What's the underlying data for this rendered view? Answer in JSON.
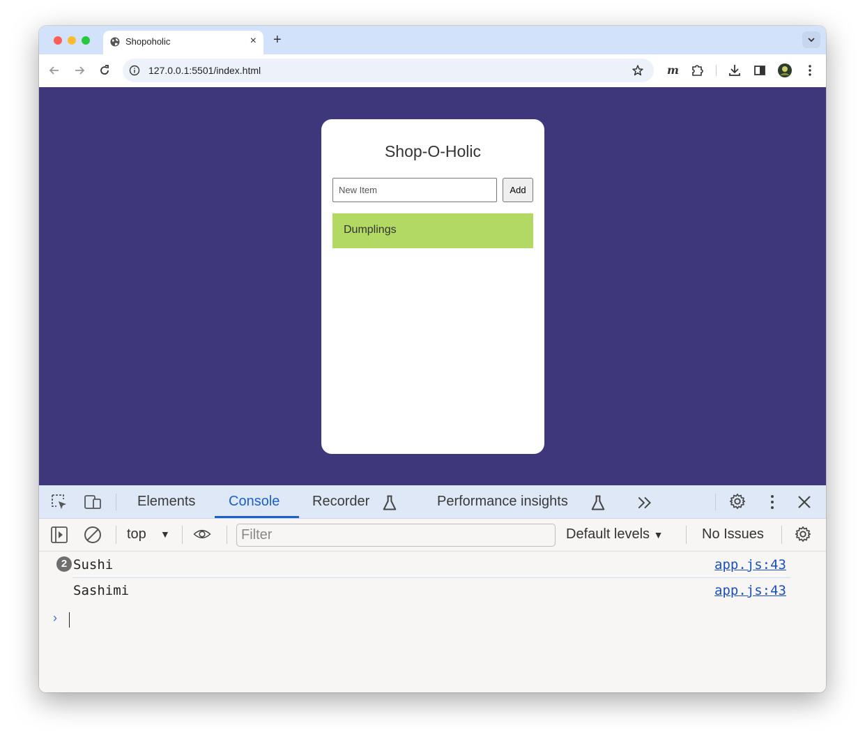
{
  "browser": {
    "tab": {
      "title": "Shopoholic",
      "close": "×"
    },
    "new_tab": "+",
    "address_bar": {
      "url": "127.0.0.1:5501/index.html"
    },
    "icons": [
      "back-arrow-icon",
      "forward-arrow-icon",
      "reload-icon",
      "site-info-icon",
      "bookmark-star-icon",
      "extension-m-icon",
      "extensions-puzzle-icon",
      "download-icon",
      "side-panel-icon",
      "profile-avatar-icon",
      "more-vert-icon"
    ]
  },
  "app": {
    "title": "Shop-O-Holic",
    "input_placeholder": "New Item",
    "add_label": "Add",
    "items": [
      "Dumplings"
    ],
    "colors": {
      "background": "#3e377c",
      "card": "#ffffff",
      "item": "#b2d963"
    }
  },
  "devtools": {
    "tabs": [
      {
        "label": "Elements",
        "active": false
      },
      {
        "label": "Console",
        "active": true
      },
      {
        "label": "Recorder",
        "active": false
      },
      {
        "label": "Performance insights",
        "active": false
      }
    ],
    "context": "top",
    "filter_placeholder": "Filter",
    "levels": "Default levels",
    "issues": "No Issues",
    "logs": [
      {
        "repeat": "2",
        "text": "Sushi",
        "source": "app.js:43"
      },
      {
        "repeat": "",
        "text": "Sashimi",
        "source": "app.js:43"
      }
    ],
    "colors": {
      "accent": "#1a5fd0",
      "tabbar": "#dfe8f6"
    }
  }
}
